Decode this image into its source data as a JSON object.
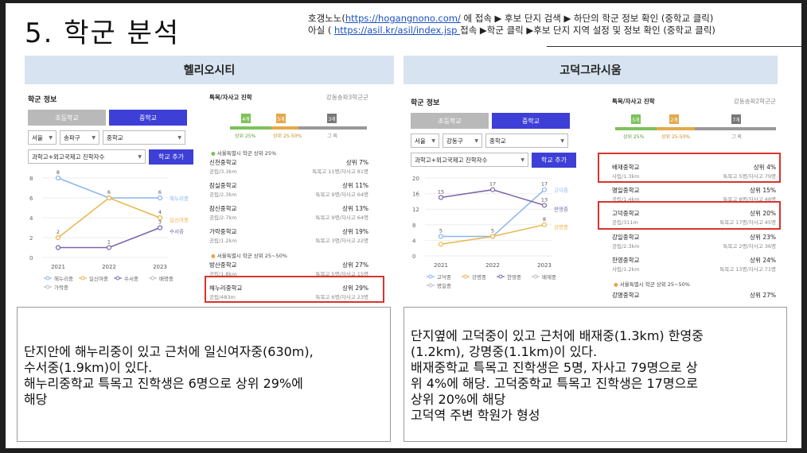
{
  "title": "5. 학군 분석",
  "source": {
    "line1_prefix": "호갱노노(",
    "line1_link": "https://hogangnono.com/",
    "line1_suffix": " 에 접속 ▶ 후보 단지 검색 ▶ 하단의 학군 정보 확인 (중학교 클릭)",
    "line2_prefix": "아실 ( ",
    "line2_link": "https://asil.kr/asil/index.jsp ",
    "line2_suffix": "접속 ▶학군 클릭 ▶후보 단지 지역 설정 및 정보 확인 (중학교 클릭)"
  },
  "left": {
    "header": "헬리오시티",
    "info_title": "학군 정보",
    "tabs": [
      "초등학교",
      "중학교"
    ],
    "selects": [
      "서울",
      "송파구",
      "중학교"
    ],
    "select2": "과학고+외고국제고 진학자수",
    "add_button": "학교 추가",
    "chart_data": {
      "type": "line",
      "x": [
        "2021",
        "2022",
        "2023"
      ],
      "ylim": [
        0,
        8
      ],
      "yticks": [
        0,
        2,
        4,
        6,
        8
      ],
      "series": [
        {
          "name": "해누리중",
          "color": "#8ab4f0",
          "values": [
            8,
            6,
            6
          ],
          "labels": [
            "8",
            "6",
            "6"
          ]
        },
        {
          "name": "일신여중",
          "color": "#e9b64a",
          "values": [
            2,
            6,
            4
          ],
          "labels": [
            "2",
            "",
            "4"
          ]
        },
        {
          "name": "수서중",
          "color": "#7a64a8",
          "values": [
            1,
            1,
            3
          ],
          "labels": [
            "",
            "1",
            "3"
          ]
        }
      ],
      "legend": [
        "해누리중",
        "일신여중",
        "수서중",
        "배명중",
        "가락중"
      ]
    },
    "rank": {
      "title": "특목/자사고 진학",
      "region": "강동송파3학군군",
      "flags": [
        "4개",
        "5개",
        "3개"
      ],
      "bar_labels": [
        "상위 25%",
        "상위 25-50%",
        "그 외"
      ],
      "group1": "서울특별시 학군 상위 25%",
      "group2": "서울특별시 학군 상위 25~50%",
      "items": [
        {
          "name": "신천중학교",
          "dist": "공립/3.3km",
          "pct": "상위 7%",
          "detail": "특목고 11명/자사고 81명"
        },
        {
          "name": "잠실중학교",
          "dist": "공립/2.3km",
          "pct": "상위 11%",
          "detail": "특목고 9명/자사고 64명"
        },
        {
          "name": "잠신중학교",
          "dist": "공립/2.7km",
          "pct": "상위 13%",
          "detail": "특목고 9명/자사고 64명"
        },
        {
          "name": "가락중학교",
          "dist": "공립/1.2km",
          "pct": "상위 19%",
          "detail": "특목고 3명/자사고 22명"
        },
        {
          "name": "방산중학교",
          "dist": "공립/1.8km",
          "pct": "상위 27%",
          "detail": "특목고 5명/자사고 15명"
        },
        {
          "name": "해누리중학교",
          "dist": "공립/483m",
          "pct": "상위 29%",
          "detail": "특목고 6명/자사고 23명"
        }
      ]
    },
    "note": [
      "단지안에 해누리중이 있고 근처에 일신여자중(630m),",
      "수서중(1.9km)이 있다.",
      "해누리중학교 특목고 진학생은 6명으로 상위 29%에",
      "해당"
    ]
  },
  "right": {
    "header": "고덕그라시움",
    "info_title": "학군 정보",
    "tabs": [
      "초등학교",
      "중학교"
    ],
    "selects": [
      "서울",
      "강동구",
      "중학교"
    ],
    "select2": "과학고+외고국제고 진학자수",
    "add_button": "학교 추가",
    "chart_data": {
      "type": "line",
      "x": [
        "2021",
        "2022",
        "2023"
      ],
      "ylim": [
        0,
        20
      ],
      "yticks": [
        0,
        4,
        8,
        12,
        16,
        20
      ],
      "series": [
        {
          "name": "고덕중",
          "color": "#8ab4f0",
          "values": [
            5,
            5,
            17
          ],
          "labels": [
            "5",
            "5",
            "17"
          ]
        },
        {
          "name": "강명중",
          "color": "#e9b64a",
          "values": [
            3,
            5,
            8
          ],
          "labels": [
            "",
            "",
            "8"
          ]
        },
        {
          "name": "한영중",
          "color": "#7a64a8",
          "values": [
            15,
            17,
            13
          ],
          "labels": [
            "15",
            "17",
            "13"
          ]
        }
      ],
      "legend": [
        "고덕중",
        "강명중",
        "한영중",
        "배재중",
        "명일중"
      ]
    },
    "rank": {
      "title": "특목/자사고 진학",
      "region": "강동송파2학군군",
      "flags": [
        "5개",
        "2개",
        "7개"
      ],
      "bar_labels": [
        "상위 25%",
        "상위 25-50%",
        "그 외"
      ],
      "group2": "서울특별시 학군 상위 25~50%",
      "items": [
        {
          "name": "배재중학교",
          "dist": "사립/1.3km",
          "pct": "상위 4%",
          "detail": "특목고 5명/자사고 79명"
        },
        {
          "name": "명일중학교",
          "dist": "공립/1.4km",
          "pct": "상위 15%",
          "detail": "특목고 8명/자사고 48명"
        },
        {
          "name": "고덕중학교",
          "dist": "공립/311m",
          "pct": "상위 20%",
          "detail": "특목고 17명/자사고 45명"
        },
        {
          "name": "강일중학교",
          "dist": "공립/2.3km",
          "pct": "상위 23%",
          "detail": "특목고 2명/자사고 36명"
        },
        {
          "name": "한영중학교",
          "dist": "사립/1.2km",
          "pct": "상위 24%",
          "detail": "특목고 13명/자사고 71명"
        },
        {
          "name": "강명중학교",
          "dist": "",
          "pct": "상위 27%",
          "detail": ""
        }
      ]
    },
    "note": [
      "단지옆에 고덕중이 있고 근처에 배재중(1.3km) 한영중",
      "(1.2km), 강명중(1.1km)이 있다.",
      "배재중학교 특목고 진학생은 5명, 자사고 79명으로 상",
      "위 4%에 해당. 고덕중학교 특목고 진학생은 17명으로",
      "상위 20%에 해당",
      "고덕역 주변 학원가 형성"
    ]
  }
}
